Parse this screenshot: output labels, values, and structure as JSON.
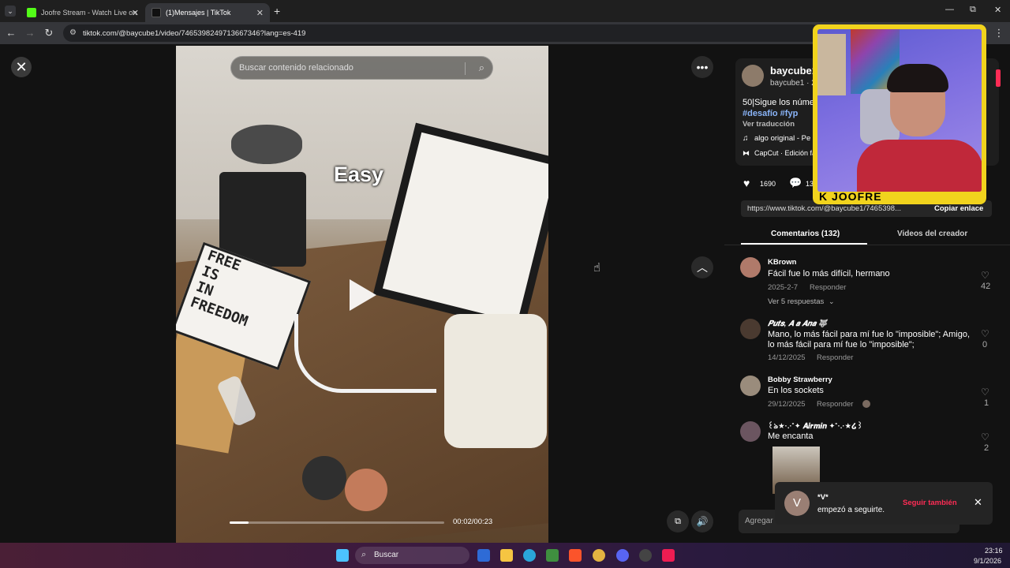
{
  "browser": {
    "tabs": [
      {
        "title": "Joofre Stream - Watch Live on",
        "active": false,
        "favicon_color": "#53fc18"
      },
      {
        "title": "(1)Mensajes | TikTok",
        "active": true,
        "favicon_color": "#111111"
      }
    ],
    "new_tab": "+",
    "url": "tiktok.com/@baycube1/video/7465398249713667346?lang=es-419",
    "window_controls": [
      "—",
      "⧉",
      "✕"
    ]
  },
  "video": {
    "search_placeholder": "Buscar contenido relacionado",
    "caption_overlay": "Easy",
    "lightbox_lines": [
      "FREE",
      "IS",
      "IN",
      "FREEDOM"
    ],
    "time_current": "00:02",
    "time_total": "00:23",
    "timecode": "00:02/00:23",
    "progress": 0.09
  },
  "creator": {
    "name": "baycube1",
    "handle": "baycube1 · 2",
    "description": "50|Sigue los núme",
    "hashtags": "#desafío #fyp",
    "translate": "Ver traducción",
    "music": "algo original - Pe",
    "capcut": "CapCut · Edición fá",
    "likes": "1690",
    "comments_short": "13",
    "share_url": "https://www.tiktok.com/@baycube1/7465398...",
    "copy_link": "Copiar enlace"
  },
  "tabs": {
    "comments": "Comentarios (132)",
    "creator_videos": "Videos del creador"
  },
  "comments": [
    {
      "user": "KBrown",
      "text": "Fácil fue lo más difícil, hermano",
      "date": "2025-2-7",
      "reply": "Responder",
      "likes": "42",
      "more": "Ver 5 respuestas",
      "avatar_color": "#b07a6a"
    },
    {
      "user": "𝑷𝒖𝒕𝒔, 𝑨 𝒂 𝑨𝒏𝒂 🐺",
      "text": "Mano, lo más fácil para mí fue lo \"imposible\"; Amigo, lo más fácil para mí fue lo \"imposible\";",
      "date": "14/12/2025",
      "reply": "Responder",
      "likes": "0",
      "avatar_color": "#4a3a30"
    },
    {
      "user": "Bobby Strawberry",
      "text": "En los sockets",
      "date": "29/12/2025",
      "reply": "Responder",
      "likes": "1",
      "avatar_color": "#9a8c7c"
    },
    {
      "user": "꒰ঌ★·.·˚✦ 𝑨𝒊𝒓𝒎𝒊𝒏 ✦˚·.·★໒꒱",
      "text": "Me encanta",
      "likes": "2",
      "avatar_color": "#6b5560"
    }
  ],
  "toast": {
    "avatar_letter": "V",
    "name": "*V*",
    "message": "empezó a seguirte.",
    "action": "Seguir también",
    "accent": "#fe2c55"
  },
  "comment_input_placeholder": "Agregar",
  "webcam_label": "K JOOFRE",
  "taskbar": {
    "search": "Buscar",
    "time": "23:16",
    "date": "9/1/2026"
  },
  "colors": {
    "tiktok_red": "#fe2c55",
    "hashtag_blue": "#8ab4f8",
    "webcam_frame": "#f1d31d"
  }
}
